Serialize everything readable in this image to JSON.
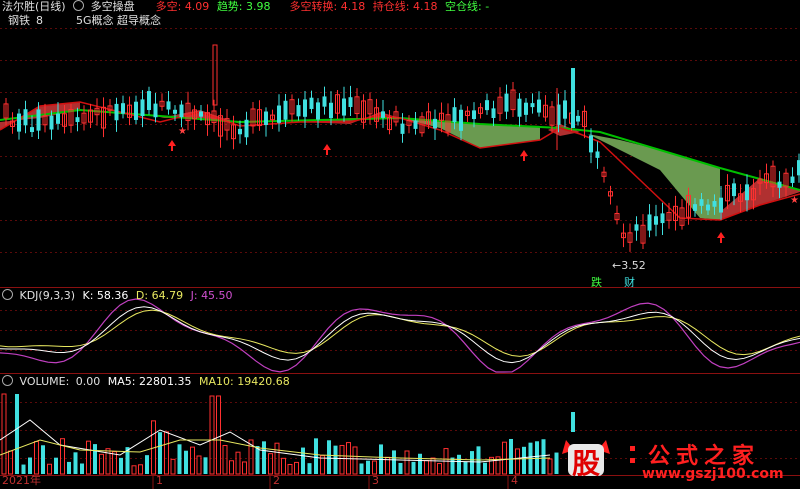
{
  "header": {
    "stock_title": "法尔胜(日线)",
    "indicator_name": "多空操盘",
    "duokong_label": "多空:",
    "duokong_value": "4.09",
    "qushi_label": "趋势:",
    "qushi_value": "3.98",
    "zhuanhuan_label": "多空转换:",
    "zhuanhuan_value": "4.18",
    "chicang_label": "持仓线:",
    "chicang_value": "4.18",
    "kongcang_label": "空仓线:",
    "kongcang_value": "-"
  },
  "concepts": {
    "tag1": "钢铁",
    "tag2": "5G概念 超导概念",
    "tag_suffix": "8"
  },
  "annotations": {
    "low_price": "3.52",
    "die_label": "跌",
    "cai_label": "财"
  },
  "kdj": {
    "name": "KDJ(9,3,3)",
    "k_label": "K:",
    "k_value": "58.36",
    "d_label": "D:",
    "d_value": "64.79",
    "j_label": "J:",
    "j_value": "45.50"
  },
  "volume": {
    "name": "VOLUME:",
    "vol_value": "0.00",
    "ma5_label": "MA5:",
    "ma5_value": "22801.35",
    "ma10_label": "MA10:",
    "ma10_value": "19420.68"
  },
  "x_axis": {
    "labels": [
      "2021年",
      "1",
      "2",
      "3",
      "4"
    ]
  },
  "watermark": {
    "glyph": "股",
    "cn": "公式之家",
    "url": "www.gszj100.com"
  },
  "colors": {
    "up": "#ff3030",
    "down": "#40e0e0",
    "trend_green": "#00c000",
    "trend_red": "#d01010",
    "fill_red": "#b03030",
    "fill_green": "#6a9a50",
    "kdj_k": "#ffffff",
    "kdj_d": "#e8e860",
    "kdj_j": "#c040c0",
    "ma5": "#ffffff",
    "ma10": "#e8e860"
  },
  "chart_data": {
    "type": "candlestick",
    "title": "法尔胜(日线)",
    "price_range": [
      3.4,
      4.8
    ],
    "low_marker": 3.52,
    "panels": [
      "price",
      "kdj",
      "volume"
    ],
    "kdj_range": [
      0,
      100
    ],
    "legend": "top-left",
    "grid": "horizontal-dashed"
  }
}
